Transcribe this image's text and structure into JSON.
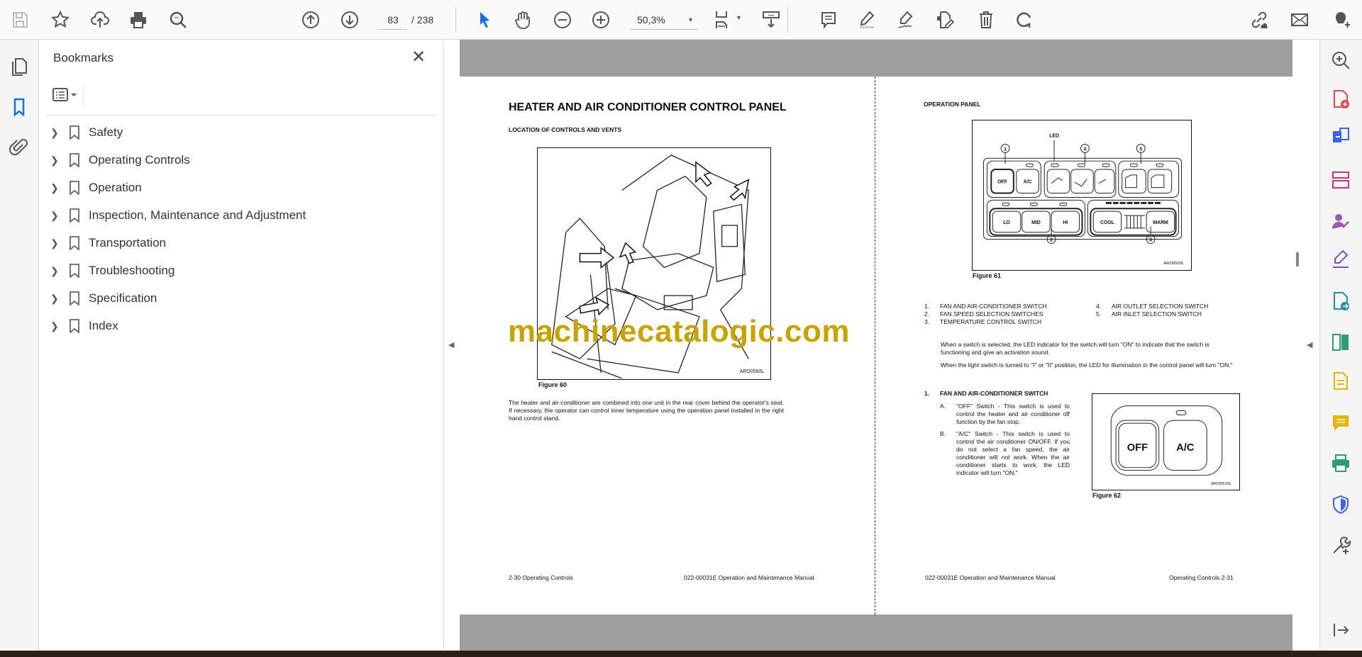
{
  "toolbar": {
    "page_current": "83",
    "page_total": "/ 238",
    "zoom": "50,3%",
    "icons": [
      "save-icon",
      "star-icon",
      "cloud-upload-icon",
      "print-icon",
      "search-icon",
      "page-up-icon",
      "page-down-icon",
      "select-cursor-icon",
      "hand-icon",
      "zoom-out-icon",
      "zoom-in-icon",
      "fit-page-icon",
      "scroll-mode-icon",
      "comment-icon",
      "highlight-icon",
      "sign-icon",
      "edit-pdf-icon",
      "delete-icon",
      "rotate-icon",
      "share-link-icon",
      "mail-icon",
      "add-user-icon"
    ]
  },
  "sidebar": {
    "title": "Bookmarks",
    "items": [
      {
        "label": "Safety"
      },
      {
        "label": "Operating Controls"
      },
      {
        "label": "Operation"
      },
      {
        "label": "Inspection, Maintenance and Adjustment"
      },
      {
        "label": "Transportation"
      },
      {
        "label": "Troubleshooting"
      },
      {
        "label": "Specification"
      },
      {
        "label": "Index"
      }
    ]
  },
  "left_page": {
    "title": "HEATER AND AIR CONDITIONER CONTROL PANEL",
    "subtitle": "LOCATION OF CONTROLS AND VENTS",
    "figure_code": "ARO0560L",
    "figure_caption": "Figure 60",
    "paragraph": "The heater and air-conditioner are combined into one unit in the rear cover behind the operator's seat. If necessary, the operator can control inner temperature using the operation panel installed in the right hand control stand.",
    "footer_left": "2-30  Operating Controls",
    "footer_right": "022-00031E Operation and Maintenance Manual"
  },
  "watermark": "machinecatalogic.com",
  "right_page": {
    "heading": "OPERATION PANEL",
    "figure61": {
      "led_label": "LED",
      "callouts": [
        "1",
        "2",
        "3",
        "4",
        "5"
      ],
      "buttons": [
        "OFF",
        "A/C",
        "LO",
        "MID",
        "HI",
        "COOL",
        "WARM"
      ],
      "code": "ARO0500L",
      "caption": "Figure 61"
    },
    "list": [
      {
        "num": "1.",
        "text": "FAN AND AIR-CONDITIONER SWITCH"
      },
      {
        "num": "2.",
        "text": "FAN SPEED SELECTION SWITCHES"
      },
      {
        "num": "3.",
        "text": "TEMPERATURE CONTROL SWITCH"
      },
      {
        "num": "4.",
        "text": "AIR OUTLET SELECTION SWITCH"
      },
      {
        "num": "5.",
        "text": "AIR INLET SELECTION SWITCH"
      }
    ],
    "para1": "When a switch is selected, the LED indicator for the switch will turn \"ON\" to indicate that the switch is functioning and give an activation sound.",
    "para2": "When the light switch is turned to \"I\" or \"II\" position, the LED for illumination in the control panel will turn \"ON.\"",
    "section_num": "1.",
    "section_title": "FAN AND AIR-CONDITIONER SWITCH",
    "sub": [
      {
        "letter": "A.",
        "text": "\"OFF\" Switch - This switch is used to control the heater and air conditioner off function by the fan stop."
      },
      {
        "letter": "B.",
        "text": "\"A/C\" Switch - This switch is used to control the air conditioner ON/OFF. If you do not select a fan speed, the air conditioner will not work. When the air conditioner starts to work, the LED indicator will turn \"ON.\""
      }
    ],
    "figure62": {
      "off": "OFF",
      "ac": "A/C",
      "code": "ARO0510L",
      "caption": "Figure 62"
    },
    "footer_left": "022-00031E Operation and Maintenance Manual",
    "footer_right": "Operating Controls 2-31"
  },
  "colors": {
    "accent": "#1473e6",
    "watermark": "#c9a400",
    "doc_bg": "#9e9e9e"
  }
}
